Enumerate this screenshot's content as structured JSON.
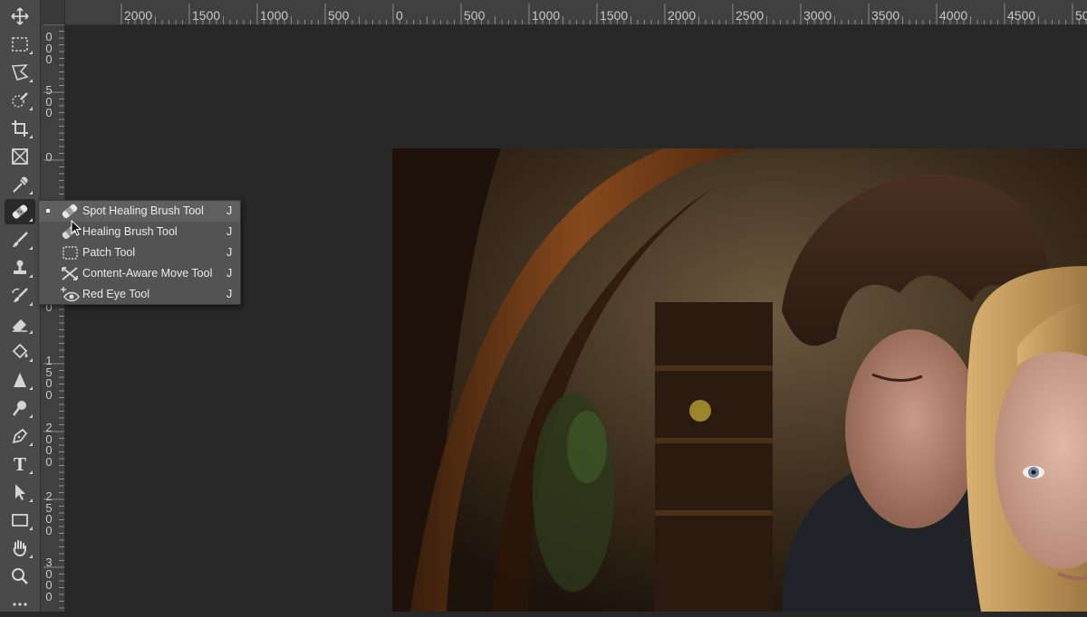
{
  "top_ruler": {
    "labels": [
      "2000",
      "1500",
      "1000",
      "500",
      "0",
      "500",
      "1000",
      "1500",
      "2000",
      "2500",
      "3000",
      "3500",
      "4000",
      "4500",
      "50"
    ]
  },
  "left_ruler": {
    "labels": [
      "0\n0\n0",
      "5\n0\n0",
      "0",
      "0",
      "1\n5\n0\n0",
      "2\n0\n0\n0",
      "2\n5\n0\n0",
      "3\n0\n0\n0"
    ]
  },
  "toolbar": {
    "tools": [
      {
        "name": "move-tool",
        "icon": "move-icon"
      },
      {
        "name": "marquee-tool",
        "icon": "rectangular-marquee-icon"
      },
      {
        "name": "lasso-tool",
        "icon": "polygonal-lasso-icon"
      },
      {
        "name": "quick-selection-tool",
        "icon": "quick-selection-icon"
      },
      {
        "name": "crop-tool",
        "icon": "crop-icon"
      },
      {
        "name": "frame-tool",
        "icon": "frame-icon"
      },
      {
        "name": "eyedropper-tool",
        "icon": "eyedropper-icon"
      },
      {
        "name": "spot-healing-tool",
        "icon": "bandage-icon"
      },
      {
        "name": "brush-tool",
        "icon": "brush-icon"
      },
      {
        "name": "clone-stamp-tool",
        "icon": "stamp-icon"
      },
      {
        "name": "history-brush-tool",
        "icon": "history-brush-icon"
      },
      {
        "name": "eraser-tool",
        "icon": "eraser-icon"
      },
      {
        "name": "paint-bucket-tool",
        "icon": "paint-bucket-icon"
      },
      {
        "name": "sharpen-tool",
        "icon": "triangle-icon"
      },
      {
        "name": "dodge-tool",
        "icon": "dodge-icon"
      },
      {
        "name": "pen-tool",
        "icon": "pen-icon"
      },
      {
        "name": "type-tool",
        "icon": "type-icon"
      },
      {
        "name": "path-selection-tool",
        "icon": "arrow-pointer-icon"
      },
      {
        "name": "rectangle-tool",
        "icon": "rectangle-icon"
      },
      {
        "name": "hand-tool",
        "icon": "hand-icon"
      },
      {
        "name": "zoom-tool",
        "icon": "magnifier-icon"
      },
      {
        "name": "more-tools",
        "icon": "ellipsis-icon"
      }
    ],
    "type_glyph": "T"
  },
  "flyout": {
    "items": [
      {
        "label": "Spot Healing Brush Tool",
        "shortcut": "J",
        "icon": "bandage-icon",
        "selected": true
      },
      {
        "label": "Healing Brush Tool",
        "shortcut": "J",
        "icon": "healing-brush-icon",
        "selected": false
      },
      {
        "label": "Patch Tool",
        "shortcut": "J",
        "icon": "patch-icon",
        "selected": false
      },
      {
        "label": "Content-Aware Move Tool",
        "shortcut": "J",
        "icon": "content-aware-move-icon",
        "selected": false
      },
      {
        "label": "Red Eye Tool",
        "shortcut": "J",
        "icon": "red-eye-icon",
        "selected": false
      }
    ]
  },
  "colors": {
    "toolbar_bg": "#4a4a4a",
    "ruler_bg": "#404040",
    "canvas_bg": "#282828",
    "menu_bg": "#535353",
    "menu_selected": "#5f5f5f"
  }
}
